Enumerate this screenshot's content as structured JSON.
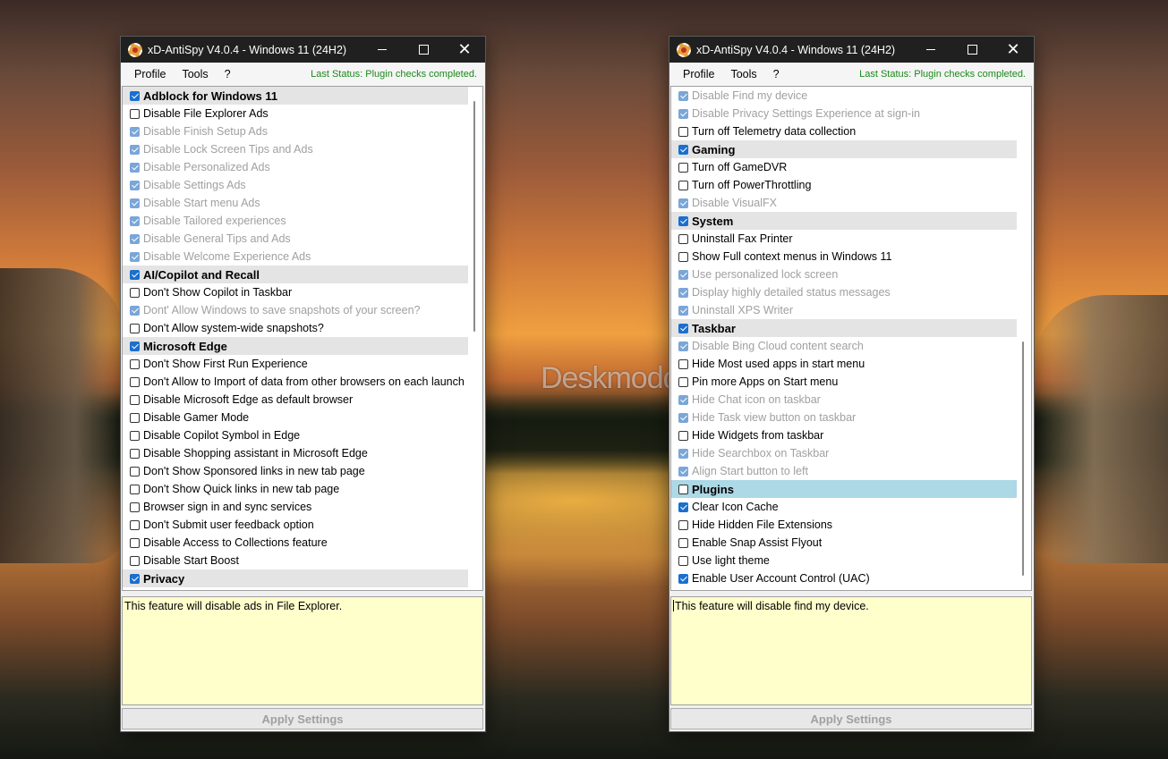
{
  "watermark": "Deskmodder.de",
  "windows": [
    {
      "title": "xD-AntiSpy V4.0.4 - Windows 11 (24H2)",
      "menu": [
        "Profile",
        "Tools",
        "?"
      ],
      "status": "Last Status: Plugin checks completed.",
      "description": "This feature will disable ads in File Explorer.",
      "apply_label": "Apply Settings",
      "rows": [
        {
          "label": "Adblock for Windows 11",
          "header": true,
          "checked": true
        },
        {
          "label": "Disable File Explorer Ads",
          "checked": false
        },
        {
          "label": "Disable Finish Setup Ads",
          "checked": true,
          "dim": true
        },
        {
          "label": "Disable Lock Screen Tips and Ads",
          "checked": true,
          "dim": true
        },
        {
          "label": "Disable Personalized Ads",
          "checked": true,
          "dim": true
        },
        {
          "label": "Disable Settings Ads",
          "checked": true,
          "dim": true
        },
        {
          "label": "Disable Start menu Ads",
          "checked": true,
          "dim": true
        },
        {
          "label": "Disable Tailored experiences",
          "checked": true,
          "dim": true
        },
        {
          "label": "Disable General Tips and Ads",
          "checked": true,
          "dim": true
        },
        {
          "label": "Disable Welcome Experience Ads",
          "checked": true,
          "dim": true
        },
        {
          "label": "AI/Copilot and Recall",
          "header": true,
          "checked": true
        },
        {
          "label": "Don't Show Copilot in Taskbar",
          "checked": false
        },
        {
          "label": "Dont' Allow Windows to save snapshots of your screen?",
          "checked": true,
          "dim": true
        },
        {
          "label": "Don't Allow system-wide snapshots?",
          "checked": false
        },
        {
          "label": "Microsoft Edge",
          "header": true,
          "checked": true
        },
        {
          "label": "Don't Show First Run Experience",
          "checked": false
        },
        {
          "label": "Don't Allow to Import of data from other browsers on each launch",
          "checked": false
        },
        {
          "label": "Disable Microsoft Edge as default browser",
          "checked": false
        },
        {
          "label": "Disable Gamer Mode",
          "checked": false
        },
        {
          "label": "Disable Copilot Symbol in Edge",
          "checked": false
        },
        {
          "label": "Disable Shopping assistant in Microsoft Edge",
          "checked": false
        },
        {
          "label": "Don't Show Sponsored links in new tab page",
          "checked": false
        },
        {
          "label": "Don't Show Quick links in new tab page",
          "checked": false
        },
        {
          "label": "Browser sign in and sync services",
          "checked": false
        },
        {
          "label": "Don't Submit user feedback option",
          "checked": false
        },
        {
          "label": "Disable Access to Collections feature",
          "checked": false
        },
        {
          "label": "Disable Start Boost",
          "checked": false
        },
        {
          "label": "Privacy",
          "header": true,
          "checked": true
        }
      ]
    },
    {
      "title": "xD-AntiSpy V4.0.4 - Windows 11 (24H2)",
      "menu": [
        "Profile",
        "Tools",
        "?"
      ],
      "status": "Last Status: Plugin checks completed.",
      "description": "This feature will disable find my device.",
      "apply_label": "Apply Settings",
      "rows": [
        {
          "label": "Disable Find my device",
          "checked": true,
          "dim": true
        },
        {
          "label": "Disable Privacy Settings Experience at sign-in",
          "checked": true,
          "dim": true
        },
        {
          "label": "Turn off Telemetry data collection",
          "checked": false
        },
        {
          "label": "Gaming",
          "header": true,
          "checked": true
        },
        {
          "label": "Turn off GameDVR",
          "checked": false
        },
        {
          "label": "Turn off PowerThrottling",
          "checked": false
        },
        {
          "label": "Disable VisualFX",
          "checked": true,
          "dim": true
        },
        {
          "label": "System",
          "header": true,
          "checked": true
        },
        {
          "label": "Uninstall Fax Printer",
          "checked": false
        },
        {
          "label": "Show Full context menus in Windows 11",
          "checked": false
        },
        {
          "label": "Use personalized lock screen",
          "checked": true,
          "dim": true
        },
        {
          "label": "Display highly detailed status messages",
          "checked": true,
          "dim": true
        },
        {
          "label": "Uninstall XPS Writer",
          "checked": true,
          "dim": true
        },
        {
          "label": "Taskbar",
          "header": true,
          "checked": true
        },
        {
          "label": "Disable Bing Cloud content search",
          "checked": true,
          "dim": true
        },
        {
          "label": "Hide Most used apps in start menu",
          "checked": false
        },
        {
          "label": "Pin more Apps on Start menu",
          "checked": false
        },
        {
          "label": "Hide Chat icon on taskbar",
          "checked": true,
          "dim": true
        },
        {
          "label": "Hide Task view button on taskbar",
          "checked": true,
          "dim": true
        },
        {
          "label": "Hide Widgets from taskbar",
          "checked": false
        },
        {
          "label": "Hide Searchbox on Taskbar",
          "checked": true,
          "dim": true
        },
        {
          "label": "Align Start button to left",
          "checked": true,
          "dim": true
        },
        {
          "label": "Plugins",
          "header": true,
          "checked": false,
          "highlight": true
        },
        {
          "label": "Clear Icon Cache",
          "checked": true
        },
        {
          "label": "Hide Hidden File Extensions",
          "checked": false
        },
        {
          "label": "Enable Snap Assist Flyout",
          "checked": false
        },
        {
          "label": "Use light theme",
          "checked": false
        },
        {
          "label": "Enable User Account Control (UAC)",
          "checked": true
        }
      ]
    }
  ]
}
